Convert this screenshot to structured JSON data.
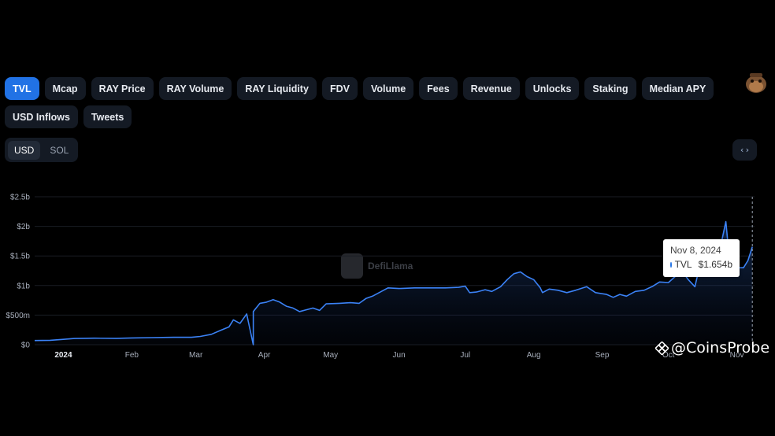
{
  "tabs": [
    {
      "label": "TVL",
      "active": true
    },
    {
      "label": "Mcap",
      "active": false
    },
    {
      "label": "RAY Price",
      "active": false
    },
    {
      "label": "RAY Volume",
      "active": false
    },
    {
      "label": "RAY Liquidity",
      "active": false
    },
    {
      "label": "FDV",
      "active": false
    },
    {
      "label": "Volume",
      "active": false
    },
    {
      "label": "Fees",
      "active": false
    },
    {
      "label": "Revenue",
      "active": false
    },
    {
      "label": "Unlocks",
      "active": false
    },
    {
      "label": "Staking",
      "active": false
    },
    {
      "label": "Median APY",
      "active": false
    },
    {
      "label": "USD Inflows",
      "active": false
    },
    {
      "label": "Tweets",
      "active": false
    }
  ],
  "currency": {
    "options": [
      "USD",
      "SOL"
    ],
    "selected": "USD"
  },
  "embed_label": "‹›",
  "tooltip": {
    "date": "Nov 8, 2024",
    "series": "TVL",
    "value": "$1.654b"
  },
  "watermark": "DefiLlama",
  "credit": "@CoinsProbe",
  "colors": {
    "accent": "#2172e5",
    "line": "#3b82f6",
    "background": "#000000",
    "panel": "#141a24"
  },
  "chart_data": {
    "type": "area",
    "title": "",
    "xlabel": "",
    "ylabel": "",
    "y_tick_labels": [
      "$0",
      "$500m",
      "$1b",
      "$1.5b",
      "$2b",
      "$2.5b"
    ],
    "y_ticks": [
      0,
      500,
      1000,
      1500,
      2000,
      2500
    ],
    "x_tick_labels": [
      "2024",
      "Feb",
      "Mar",
      "Apr",
      "May",
      "Jun",
      "Jul",
      "Aug",
      "Sep",
      "Oct",
      "Nov"
    ],
    "x_ticks": [
      "2024-01-01",
      "2024-02-01",
      "2024-03-01",
      "2024-04-01",
      "2024-05-01",
      "2024-06-01",
      "2024-07-01",
      "2024-08-01",
      "2024-09-01",
      "2024-10-01",
      "2024-11-01"
    ],
    "x_range": [
      "2023-12-19",
      "2024-11-09"
    ],
    "ylim": [
      0,
      2500
    ],
    "grid": "horizontal",
    "series": [
      {
        "name": "TVL",
        "unit": "USD millions",
        "color": "#3b82f6",
        "points": [
          [
            "2023-12-19",
            70
          ],
          [
            "2023-12-26",
            75
          ],
          [
            "2024-01-01",
            90
          ],
          [
            "2024-01-06",
            105
          ],
          [
            "2024-01-15",
            110
          ],
          [
            "2024-01-25",
            108
          ],
          [
            "2024-02-01",
            115
          ],
          [
            "2024-02-10",
            120
          ],
          [
            "2024-02-20",
            125
          ],
          [
            "2024-02-28",
            125
          ],
          [
            "2024-03-03",
            140
          ],
          [
            "2024-03-08",
            175
          ],
          [
            "2024-03-12",
            240
          ],
          [
            "2024-03-16",
            300
          ],
          [
            "2024-03-18",
            420
          ],
          [
            "2024-03-21",
            360
          ],
          [
            "2024-03-24",
            520
          ],
          [
            "2024-03-27,",
            0
          ],
          [
            "2024-03-27",
            560
          ],
          [
            "2024-03-30",
            700
          ],
          [
            "2024-04-02",
            720
          ],
          [
            "2024-04-05",
            760
          ],
          [
            "2024-04-08",
            720
          ],
          [
            "2024-04-11",
            650
          ],
          [
            "2024-04-14",
            620
          ],
          [
            "2024-04-17",
            560
          ],
          [
            "2024-04-20",
            590
          ],
          [
            "2024-04-23",
            620
          ],
          [
            "2024-04-26",
            580
          ],
          [
            "2024-04-29",
            690
          ],
          [
            "2024-05-05",
            700
          ],
          [
            "2024-05-10",
            710
          ],
          [
            "2024-05-14",
            700
          ],
          [
            "2024-05-17",
            780
          ],
          [
            "2024-05-20",
            820
          ],
          [
            "2024-05-24",
            900
          ],
          [
            "2024-05-27",
            960
          ],
          [
            "2024-06-01",
            950
          ],
          [
            "2024-06-08",
            960
          ],
          [
            "2024-06-15",
            960
          ],
          [
            "2024-06-22",
            960
          ],
          [
            "2024-06-28",
            970
          ],
          [
            "2024-07-01",
            990
          ],
          [
            "2024-07-03",
            880
          ],
          [
            "2024-07-06",
            890
          ],
          [
            "2024-07-10",
            930
          ],
          [
            "2024-07-13",
            900
          ],
          [
            "2024-07-17",
            980
          ],
          [
            "2024-07-20",
            1100
          ],
          [
            "2024-07-23",
            1200
          ],
          [
            "2024-07-26",
            1230
          ],
          [
            "2024-07-29",
            1150
          ],
          [
            "2024-08-01",
            1100
          ],
          [
            "2024-08-04",
            960
          ],
          [
            "2024-08-05",
            880
          ],
          [
            "2024-08-08",
            940
          ],
          [
            "2024-08-12",
            920
          ],
          [
            "2024-08-16",
            880
          ],
          [
            "2024-08-20",
            920
          ],
          [
            "2024-08-25",
            980
          ],
          [
            "2024-08-29",
            880
          ],
          [
            "2024-09-03",
            850
          ],
          [
            "2024-09-06",
            800
          ],
          [
            "2024-09-09",
            850
          ],
          [
            "2024-09-12",
            820
          ],
          [
            "2024-09-16",
            900
          ],
          [
            "2024-09-20",
            920
          ],
          [
            "2024-09-24",
            990
          ],
          [
            "2024-09-27",
            1060
          ],
          [
            "2024-10-01",
            1050
          ],
          [
            "2024-10-04",
            1150
          ],
          [
            "2024-10-07",
            1250
          ],
          [
            "2024-10-10",
            1100
          ],
          [
            "2024-10-13",
            980
          ],
          [
            "2024-10-15",
            1300
          ],
          [
            "2024-10-18",
            1320
          ],
          [
            "2024-10-21",
            1300
          ],
          [
            "2024-10-24",
            1550
          ],
          [
            "2024-10-27",
            2080
          ],
          [
            "2024-10-29",
            1300
          ],
          [
            "2024-11-01",
            1300
          ],
          [
            "2024-11-04",
            1300
          ],
          [
            "2024-11-06",
            1420
          ],
          [
            "2024-11-08",
            1654
          ]
        ]
      }
    ],
    "tooltip_point": [
      "2024-11-08",
      1654
    ]
  }
}
